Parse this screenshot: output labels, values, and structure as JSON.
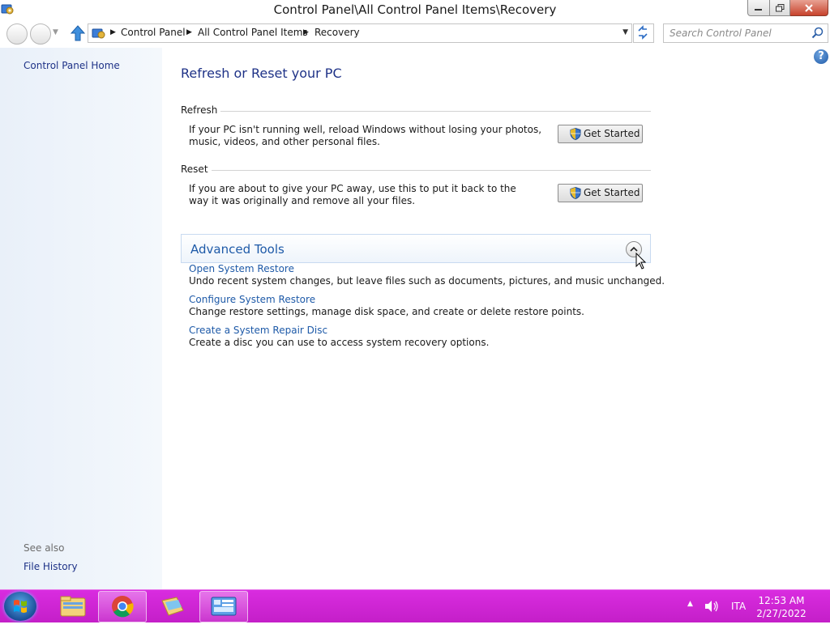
{
  "window": {
    "title": "Control Panel\\All Control Panel Items\\Recovery"
  },
  "nav": {
    "breadcrumbs": [
      "Control Panel",
      "All Control Panel Items",
      "Recovery"
    ],
    "search_placeholder": "Search Control Panel"
  },
  "sidebar": {
    "home_label": "Control Panel Home",
    "see_also_label": "See also",
    "links": [
      "File History"
    ]
  },
  "main": {
    "title": "Refresh or Reset your PC",
    "refresh": {
      "heading": "Refresh",
      "description": "If your PC isn't running well, reload Windows without losing your photos, music, videos, and other personal files.",
      "button_label": "Get Started"
    },
    "reset": {
      "heading": "Reset",
      "description": "If you are about to give your PC away, use this to put it back to the way it was originally and remove all your files.",
      "button_label": "Get Started"
    },
    "advanced_tools": {
      "title": "Advanced Tools",
      "items": [
        {
          "link": "Open System Restore",
          "description": "Undo recent system changes, but leave files such as documents, pictures, and music unchanged."
        },
        {
          "link": "Configure System Restore",
          "description": "Change restore settings, manage disk space, and create or delete restore points."
        },
        {
          "link": "Create a System Repair Disc",
          "description": "Create a disc you can use to access system recovery options."
        }
      ]
    }
  },
  "taskbar": {
    "language": "ITA",
    "time": "12:53 AM",
    "date": "2/27/2022",
    "pinned": [
      "file-explorer",
      "chrome",
      "windows-explorer-folder",
      "control-panel"
    ],
    "accent_color": "#c41fc8"
  },
  "colors": {
    "link": "#1e5aa8",
    "heading": "#1e3287"
  }
}
